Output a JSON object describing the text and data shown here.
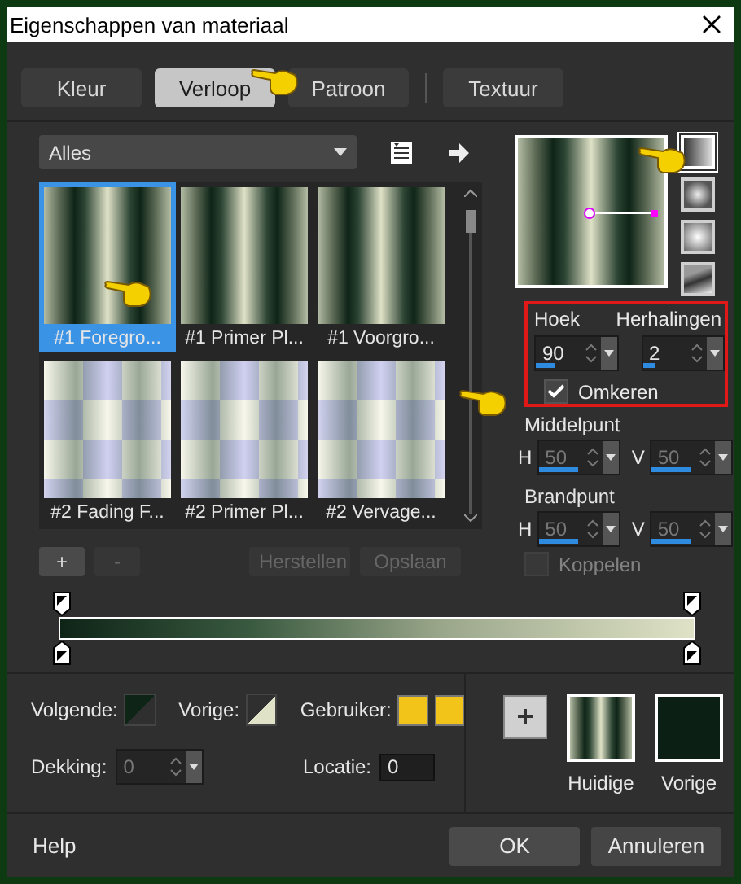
{
  "window": {
    "title": "Eigenschappen van materiaal"
  },
  "tabs": [
    {
      "label": "Kleur",
      "selected": false
    },
    {
      "label": "Verloop",
      "selected": true
    },
    {
      "label": "Patroon",
      "selected": false
    },
    {
      "label": "Textuur",
      "selected": false
    }
  ],
  "category": {
    "value": "Alles"
  },
  "gradients": [
    {
      "label": "#1 Foregro...",
      "kind": "stripes",
      "selected": true
    },
    {
      "label": "#1 Primer Pl...",
      "kind": "stripes",
      "selected": false
    },
    {
      "label": "#1 Voorgro...",
      "kind": "stripes",
      "selected": false
    },
    {
      "label": "#2 Fading F...",
      "kind": "checker",
      "selected": false
    },
    {
      "label": "#2 Primer Pl...",
      "kind": "checker",
      "selected": false
    },
    {
      "label": "#2 Vervage...",
      "kind": "checker",
      "selected": false
    }
  ],
  "styles": [
    {
      "kind": "linear",
      "selected": true
    },
    {
      "kind": "rectangular",
      "selected": false
    },
    {
      "kind": "sunburst",
      "selected": false
    },
    {
      "kind": "radial",
      "selected": false
    }
  ],
  "angle": {
    "label": "Hoek",
    "value": "90",
    "level": 0.25
  },
  "repeats": {
    "label": "Herhalingen",
    "value": "2",
    "level": 0.15
  },
  "invert": {
    "label": "Omkeren",
    "checked": true
  },
  "center": {
    "label": "Middelpunt",
    "disabled": true,
    "fields": [
      {
        "label": "H",
        "value": "50",
        "level": 0.5
      },
      {
        "label": "V",
        "value": "50",
        "level": 0.5
      }
    ]
  },
  "focus": {
    "label": "Brandpunt",
    "disabled": true,
    "fields": [
      {
        "label": "H",
        "value": "50",
        "level": 0.5
      },
      {
        "label": "V",
        "value": "50",
        "level": 0.5
      }
    ]
  },
  "link": {
    "label": "Koppelen",
    "checked": false,
    "disabled": true
  },
  "editor_buttons": [
    {
      "label": "+",
      "disabled": false
    },
    {
      "label": "-",
      "disabled": true
    },
    {
      "label": "Herstellen",
      "disabled": true
    },
    {
      "label": "Opslaan",
      "disabled": true
    }
  ],
  "stop_colors": [
    {
      "label": "Volgende:",
      "kind": "next"
    },
    {
      "label": "Vorige:",
      "kind": "previous"
    },
    {
      "label": "Gebruiker:",
      "kind": "user"
    }
  ],
  "opacity": {
    "label": "Dekking:",
    "value": "0",
    "disabled": true
  },
  "location": {
    "label": "Locatie:",
    "value": "0"
  },
  "add_button": {
    "label": "+"
  },
  "swatches": [
    {
      "label": "Huidige",
      "kind": "gradient"
    },
    {
      "label": "Vorige",
      "kind": "solid"
    }
  ],
  "buttons": [
    {
      "label": "Help",
      "kind": "link"
    },
    {
      "label": "OK",
      "kind": "primary"
    },
    {
      "label": "Annuleren",
      "kind": "secondary"
    }
  ]
}
